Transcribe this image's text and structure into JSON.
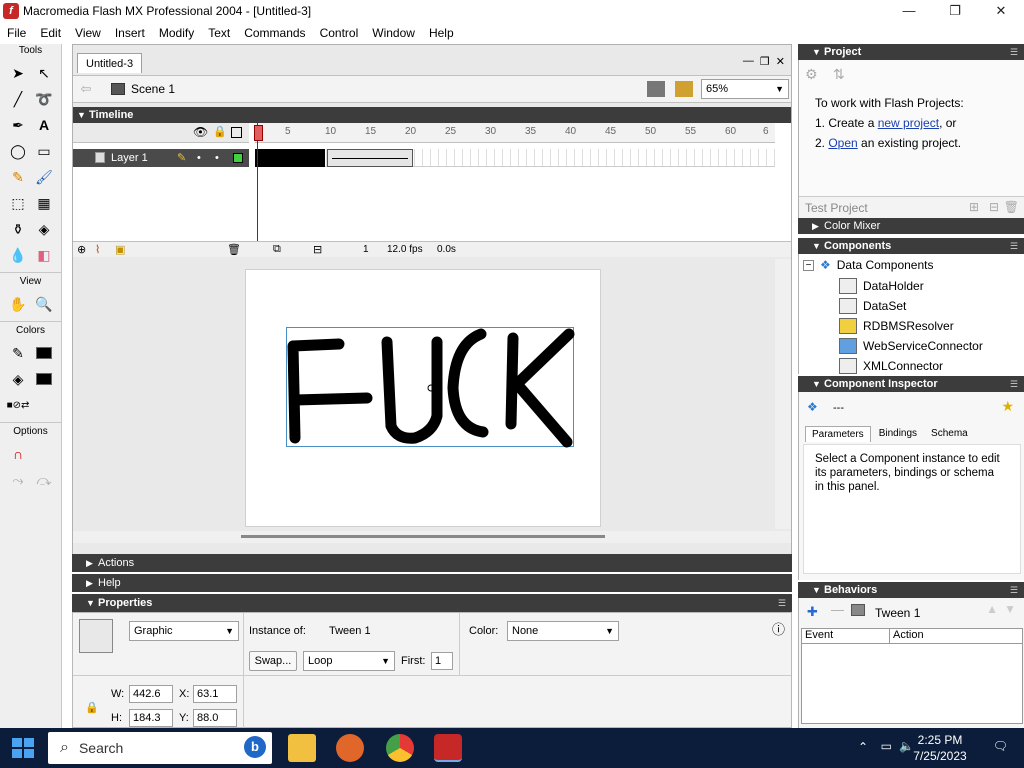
{
  "window": {
    "title": "Macromedia Flash MX Professional 2004 - [Untitled-3]",
    "minimize": "—",
    "maximize": "❐",
    "close": "✕"
  },
  "menu": [
    "File",
    "Edit",
    "View",
    "Insert",
    "Modify",
    "Text",
    "Commands",
    "Control",
    "Window",
    "Help"
  ],
  "tools": {
    "header": "Tools",
    "view_header": "View",
    "colors_header": "Colors",
    "options_header": "Options"
  },
  "document": {
    "tab": "Untitled-3",
    "scene": "Scene 1",
    "zoom": "65%"
  },
  "timeline": {
    "header": "Timeline",
    "layer_name": "Layer 1",
    "ruler": [
      "1",
      "5",
      "10",
      "15",
      "20",
      "25",
      "30",
      "35",
      "40",
      "45",
      "50",
      "55",
      "60",
      "6"
    ],
    "current_frame": "1",
    "fps": "12.0 fps",
    "time": "0.0s"
  },
  "panels": {
    "actions": "Actions",
    "help": "Help",
    "properties": "Properties"
  },
  "properties": {
    "symbol_type": "Graphic",
    "instance_of_label": "Instance of:",
    "instance_name": "Tween 1",
    "color_label": "Color:",
    "color_value": "None",
    "swap_button": "Swap...",
    "loop_value": "Loop",
    "first_label": "First:",
    "first_value": "1",
    "w_label": "W:",
    "w_value": "442.6",
    "x_label": "X:",
    "x_value": "63.1",
    "h_label": "H:",
    "h_value": "184.3",
    "y_label": "Y:",
    "y_value": "88.0"
  },
  "project": {
    "header": "Project",
    "intro": "To work with Flash Projects:",
    "step1_prefix": "1. Create a ",
    "step1_link": "new project",
    "step1_suffix": ", or",
    "step2_prefix": "2. ",
    "step2_link": "Open",
    "step2_suffix": " an existing project.",
    "test_button": "Test Project"
  },
  "color_mixer": {
    "header": "Color Mixer"
  },
  "components": {
    "header": "Components",
    "category": "Data Components",
    "items": [
      "DataHolder",
      "DataSet",
      "RDBMSResolver",
      "WebServiceConnector",
      "XMLConnector"
    ]
  },
  "inspector": {
    "header": "Component Inspector",
    "name": "---",
    "tabs": [
      "Parameters",
      "Bindings",
      "Schema"
    ],
    "message": "Select a Component instance to edit its parameters, bindings or schema in this panel."
  },
  "behaviors": {
    "header": "Behaviors",
    "instance": "Tween 1",
    "col_event": "Event",
    "col_action": "Action"
  },
  "taskbar": {
    "search": "Search",
    "time": "2:25 PM",
    "date": "7/25/2023"
  },
  "colors": {
    "panel_header": "#3c3c3c",
    "taskbar": "#0b1d3a",
    "selection": "#4a90c8",
    "link": "#1a3fb0"
  }
}
